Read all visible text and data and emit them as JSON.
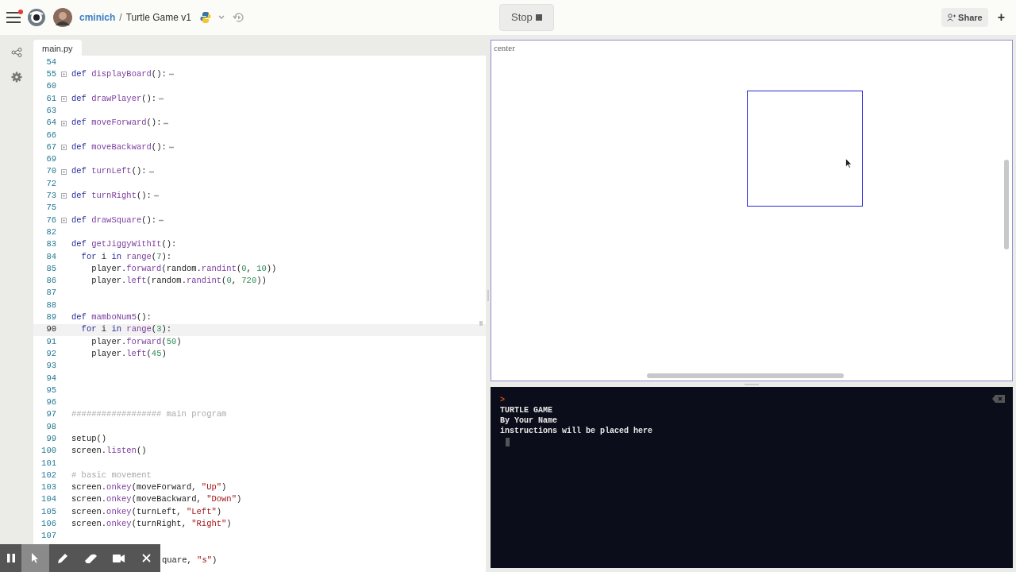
{
  "header": {
    "user": "cminich",
    "separator": "/",
    "project": "Turtle Game v1",
    "run_button": "Stop",
    "share_button": "Share",
    "add_button": "+",
    "notification": true
  },
  "editor": {
    "tab": "main.py",
    "lines": [
      {
        "number": "54",
        "current": false
      },
      {
        "number": "55",
        "current": false,
        "folded": true,
        "tokens": [
          {
            "kind": "kw",
            "text": "def "
          },
          {
            "kind": "fn",
            "text": "displayBoard"
          },
          {
            "kind": "plain",
            "text": "():"
          }
        ]
      },
      {
        "number": "60",
        "current": false
      },
      {
        "number": "61",
        "current": false,
        "folded": true,
        "tokens": [
          {
            "kind": "kw",
            "text": "def "
          },
          {
            "kind": "fn",
            "text": "drawPlayer"
          },
          {
            "kind": "plain",
            "text": "():"
          }
        ]
      },
      {
        "number": "63",
        "current": false
      },
      {
        "number": "64",
        "current": false,
        "folded": true,
        "tokens": [
          {
            "kind": "kw",
            "text": "def "
          },
          {
            "kind": "fn",
            "text": "moveForward"
          },
          {
            "kind": "plain",
            "text": "():"
          }
        ]
      },
      {
        "number": "66",
        "current": false
      },
      {
        "number": "67",
        "current": false,
        "folded": true,
        "tokens": [
          {
            "kind": "kw",
            "text": "def "
          },
          {
            "kind": "fn",
            "text": "moveBackward"
          },
          {
            "kind": "plain",
            "text": "():"
          }
        ]
      },
      {
        "number": "69",
        "current": false
      },
      {
        "number": "70",
        "current": false,
        "folded": true,
        "tokens": [
          {
            "kind": "kw",
            "text": "def "
          },
          {
            "kind": "fn",
            "text": "turnLeft"
          },
          {
            "kind": "plain",
            "text": "():"
          }
        ]
      },
      {
        "number": "72",
        "current": false
      },
      {
        "number": "73",
        "current": false,
        "folded": true,
        "tokens": [
          {
            "kind": "kw",
            "text": "def "
          },
          {
            "kind": "fn",
            "text": "turnRight"
          },
          {
            "kind": "plain",
            "text": "():"
          }
        ]
      },
      {
        "number": "75",
        "current": false
      },
      {
        "number": "76",
        "current": false,
        "folded": true,
        "tokens": [
          {
            "kind": "kw",
            "text": "def "
          },
          {
            "kind": "fn",
            "text": "drawSquare"
          },
          {
            "kind": "plain",
            "text": "():"
          }
        ]
      },
      {
        "number": "82",
        "current": false
      },
      {
        "number": "83",
        "current": false,
        "tokens": [
          {
            "kind": "kw",
            "text": "def "
          },
          {
            "kind": "fn",
            "text": "getJiggyWithIt"
          },
          {
            "kind": "plain",
            "text": "():"
          }
        ]
      },
      {
        "number": "84",
        "current": false,
        "tokens": [
          {
            "kind": "kw",
            "text": "  for "
          },
          {
            "kind": "plain",
            "text": "i "
          },
          {
            "kind": "kw",
            "text": "in "
          },
          {
            "kind": "fn",
            "text": "range"
          },
          {
            "kind": "plain",
            "text": "("
          },
          {
            "kind": "num",
            "text": "7"
          },
          {
            "kind": "plain",
            "text": "):"
          }
        ]
      },
      {
        "number": "85",
        "current": false,
        "tokens": [
          {
            "kind": "plain",
            "text": "    player."
          },
          {
            "kind": "fn",
            "text": "forward"
          },
          {
            "kind": "plain",
            "text": "(random."
          },
          {
            "kind": "fn",
            "text": "randint"
          },
          {
            "kind": "plain",
            "text": "("
          },
          {
            "kind": "num",
            "text": "0"
          },
          {
            "kind": "plain",
            "text": ", "
          },
          {
            "kind": "num",
            "text": "10"
          },
          {
            "kind": "plain",
            "text": "))"
          }
        ]
      },
      {
        "number": "86",
        "current": false,
        "tokens": [
          {
            "kind": "plain",
            "text": "    player."
          },
          {
            "kind": "fn",
            "text": "left"
          },
          {
            "kind": "plain",
            "text": "(random."
          },
          {
            "kind": "fn",
            "text": "randint"
          },
          {
            "kind": "plain",
            "text": "("
          },
          {
            "kind": "num",
            "text": "0"
          },
          {
            "kind": "plain",
            "text": ", "
          },
          {
            "kind": "num",
            "text": "720"
          },
          {
            "kind": "plain",
            "text": "))"
          }
        ]
      },
      {
        "number": "87",
        "current": false
      },
      {
        "number": "88",
        "current": false
      },
      {
        "number": "89",
        "current": false,
        "tokens": [
          {
            "kind": "kw",
            "text": "def "
          },
          {
            "kind": "fn",
            "text": "mamboNum5"
          },
          {
            "kind": "plain",
            "text": "():"
          }
        ]
      },
      {
        "number": "90",
        "current": true,
        "tokens": [
          {
            "kind": "kw",
            "text": "  for "
          },
          {
            "kind": "plain",
            "text": "i "
          },
          {
            "kind": "kw",
            "text": "in "
          },
          {
            "kind": "fn",
            "text": "range"
          },
          {
            "kind": "plain",
            "text": "("
          },
          {
            "kind": "num",
            "text": "3"
          },
          {
            "kind": "plain",
            "text": "):"
          }
        ]
      },
      {
        "number": "91",
        "current": false,
        "tokens": [
          {
            "kind": "plain",
            "text": "    player."
          },
          {
            "kind": "fn",
            "text": "forward"
          },
          {
            "kind": "plain",
            "text": "("
          },
          {
            "kind": "num",
            "text": "50"
          },
          {
            "kind": "plain",
            "text": ")"
          }
        ]
      },
      {
        "number": "92",
        "current": false,
        "tokens": [
          {
            "kind": "plain",
            "text": "    player."
          },
          {
            "kind": "fn",
            "text": "left"
          },
          {
            "kind": "plain",
            "text": "("
          },
          {
            "kind": "num",
            "text": "45"
          },
          {
            "kind": "plain",
            "text": ")"
          }
        ]
      },
      {
        "number": "93",
        "current": false
      },
      {
        "number": "94",
        "current": false
      },
      {
        "number": "95",
        "current": false
      },
      {
        "number": "96",
        "current": false
      },
      {
        "number": "97",
        "current": false,
        "tokens": [
          {
            "kind": "comment",
            "text": "################## main program"
          }
        ]
      },
      {
        "number": "98",
        "current": false
      },
      {
        "number": "99",
        "current": false,
        "tokens": [
          {
            "kind": "plain",
            "text": "setup()"
          }
        ]
      },
      {
        "number": "100",
        "current": false,
        "tokens": [
          {
            "kind": "plain",
            "text": "screen."
          },
          {
            "kind": "fn",
            "text": "listen"
          },
          {
            "kind": "plain",
            "text": "()"
          }
        ]
      },
      {
        "number": "101",
        "current": false
      },
      {
        "number": "102",
        "current": false,
        "tokens": [
          {
            "kind": "comment",
            "text": "# basic movement"
          }
        ]
      },
      {
        "number": "103",
        "current": false,
        "tokens": [
          {
            "kind": "plain",
            "text": "screen."
          },
          {
            "kind": "fn",
            "text": "onkey"
          },
          {
            "kind": "plain",
            "text": "(moveForward, "
          },
          {
            "kind": "str",
            "text": "\"Up\""
          },
          {
            "kind": "plain",
            "text": ")"
          }
        ]
      },
      {
        "number": "104",
        "current": false,
        "tokens": [
          {
            "kind": "plain",
            "text": "screen."
          },
          {
            "kind": "fn",
            "text": "onkey"
          },
          {
            "kind": "plain",
            "text": "(moveBackward, "
          },
          {
            "kind": "str",
            "text": "\"Down\""
          },
          {
            "kind": "plain",
            "text": ")"
          }
        ]
      },
      {
        "number": "105",
        "current": false,
        "tokens": [
          {
            "kind": "plain",
            "text": "screen."
          },
          {
            "kind": "fn",
            "text": "onkey"
          },
          {
            "kind": "plain",
            "text": "(turnLeft, "
          },
          {
            "kind": "str",
            "text": "\"Left\""
          },
          {
            "kind": "plain",
            "text": ")"
          }
        ]
      },
      {
        "number": "106",
        "current": false,
        "tokens": [
          {
            "kind": "plain",
            "text": "screen."
          },
          {
            "kind": "fn",
            "text": "onkey"
          },
          {
            "kind": "plain",
            "text": "(turnRight, "
          },
          {
            "kind": "str",
            "text": "\"Right\""
          },
          {
            "kind": "plain",
            "text": ")"
          }
        ]
      },
      {
        "number": "107",
        "current": false
      },
      {
        "current": false,
        "clipped": true,
        "tokens": [
          {
            "kind": "plain",
            "text": "quare, "
          },
          {
            "kind": "str",
            "text": "\"s\""
          },
          {
            "kind": "plain",
            "text": ")"
          }
        ]
      }
    ]
  },
  "canvas": {
    "label": "center"
  },
  "console": {
    "prompt": ">",
    "lines": [
      "TURTLE GAME",
      "By Your Name",
      "instructions will be placed here"
    ]
  },
  "overlay_toolbar": {
    "tools": [
      {
        "kind": "pause",
        "selected": false
      },
      {
        "kind": "pointer",
        "selected": true
      },
      {
        "kind": "pen",
        "selected": false
      },
      {
        "kind": "eraser",
        "selected": false
      },
      {
        "kind": "camera",
        "selected": false
      },
      {
        "kind": "close",
        "selected": false
      }
    ]
  }
}
